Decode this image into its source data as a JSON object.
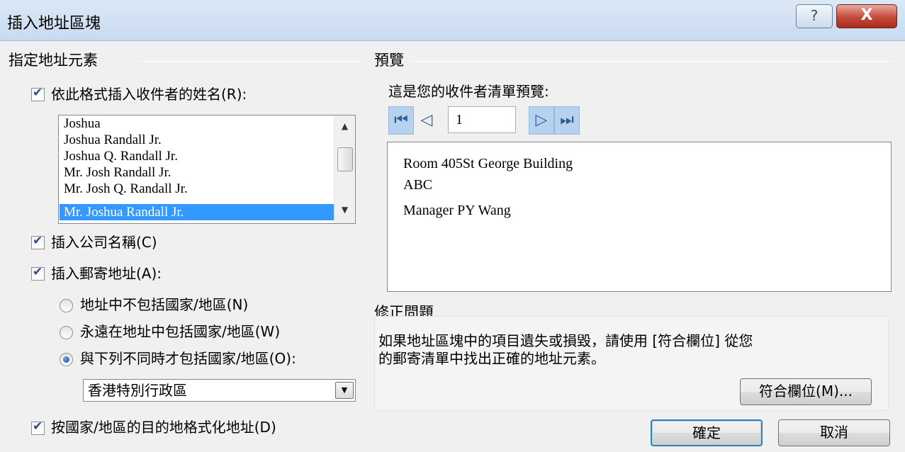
{
  "window": {
    "title": "插入地址區塊",
    "help_label": "?",
    "close_label": "X"
  },
  "left": {
    "section_title": "指定地址元素",
    "name_check_label": "依此格式插入收件者的姓名(R):",
    "name_formats": [
      "Joshua",
      "Joshua Randall Jr.",
      "Joshua Q. Randall Jr.",
      "Mr. Josh Randall Jr.",
      "Mr. Josh Q. Randall Jr.",
      "Mr. Joshua Randall Jr."
    ],
    "selected_format_index": 5,
    "company_check_label": "插入公司名稱(C)",
    "postal_check_label": "插入郵寄地址(A):",
    "radio_never": "地址中不包括國家/地區(N)",
    "radio_always": "永遠在地址中包括國家/地區(W)",
    "radio_only_if": "與下列不同時才包括國家/地區(O):",
    "country_value": "香港特別行政區",
    "format_check_label": "按國家/地區的目的地格式化地址(D)"
  },
  "preview": {
    "section_title": "預覽",
    "subtitle": "這是您的收件者清單預覽:",
    "page_value": "1",
    "address_lines": [
      "Room 405St George Building",
      "ABC",
      "Manager PY  Wang"
    ]
  },
  "fix": {
    "section_title": "修正問題",
    "text_line1": "如果地址區塊中的項目遺失或損毀，請使用 [符合欄位] 從您",
    "text_line2": "的郵寄清單中找出正確的地址元素。",
    "match_button": "符合欄位(M)..."
  },
  "buttons": {
    "ok": "確定",
    "cancel": "取消"
  }
}
